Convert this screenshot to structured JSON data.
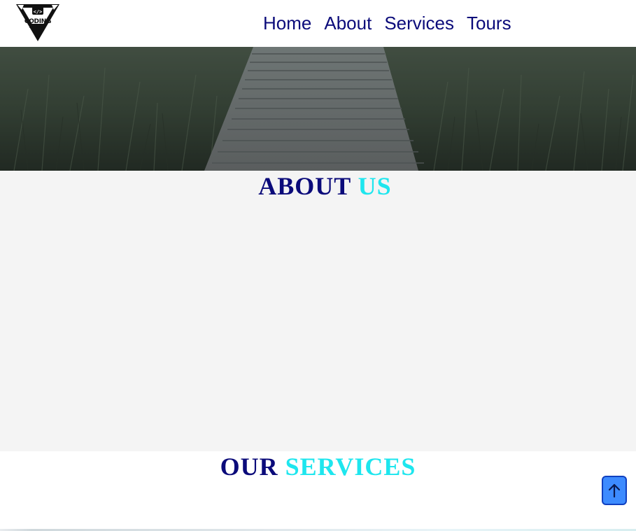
{
  "brand": {
    "logo_text": "CODING",
    "logo_subtext": "ADDICT",
    "logo_icon": "code-brackets-icon"
  },
  "nav": {
    "items": [
      {
        "label": "Home"
      },
      {
        "label": "About"
      },
      {
        "label": "Services"
      },
      {
        "label": "Tours"
      }
    ]
  },
  "about": {
    "title_part1": "ABOUT",
    "title_part2": "US"
  },
  "services": {
    "title_part1": "OUR",
    "title_part2": "SERVICES"
  },
  "scroll_top": {
    "icon": "arrow-up-icon"
  },
  "colors": {
    "nav_text": "#0b0b7a",
    "title_dark": "#0b0b7a",
    "title_accent": "#1ee6ee",
    "scroll_button": "#3d8bff",
    "about_bg": "#f4f4f4"
  }
}
